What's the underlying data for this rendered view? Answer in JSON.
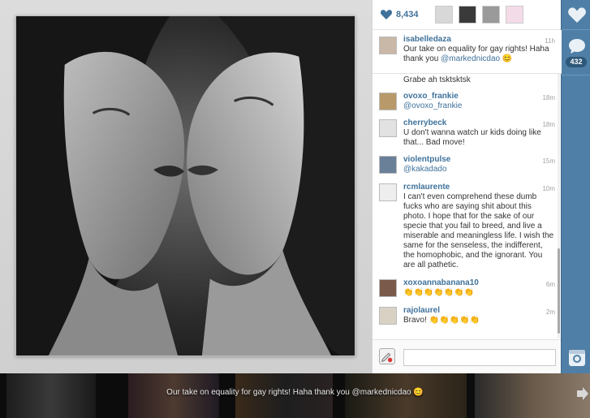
{
  "likes": {
    "count": "8,434"
  },
  "caption": {
    "username": "isabelledaza",
    "time": "11h",
    "text": "Our take on equality for gay rights! Haha thank you",
    "mention": "@markednicdao",
    "emoji": "😊"
  },
  "comments": [
    {
      "username": "",
      "time": "",
      "text": "Grabe ah tsktsktsk"
    },
    {
      "username": "ovoxo_frankie",
      "time": "18m",
      "text": "@ovoxo_frankie"
    },
    {
      "username": "cherrybeck",
      "time": "18m",
      "text": "U don't wanna watch ur kids doing like that... Bad move!"
    },
    {
      "username": "violentpulse",
      "time": "15m",
      "text": "@kakadado"
    },
    {
      "username": "rcmlaurente",
      "time": "10m",
      "text": "I can't even comprehend these dumb fucks who are saying shit about this photo. I hope that for the sake of our specie that you fail to breed, and live a miserable and meaningless life. I wish the same for the senseless, the indifferent, the homophobic, and the ignorant. You are all pathetic."
    },
    {
      "username": "xoxoannabanana10",
      "time": "6m",
      "text": "👏👏👏👏👏👏👏"
    },
    {
      "username": "rajolaurel",
      "time": "2m",
      "text": "Bravo! 👏👏👏👏👏"
    }
  ],
  "input": {
    "placeholder": ""
  },
  "sidebar": {
    "comment_count": "432"
  },
  "filmstrip": {
    "caption": "Our take on equality for gay rights! Haha thank you @markednicdao 😊"
  },
  "colors": {
    "accent": "#3f729b",
    "sidebar": "#4f7fa6",
    "badge": "#2e5879"
  }
}
